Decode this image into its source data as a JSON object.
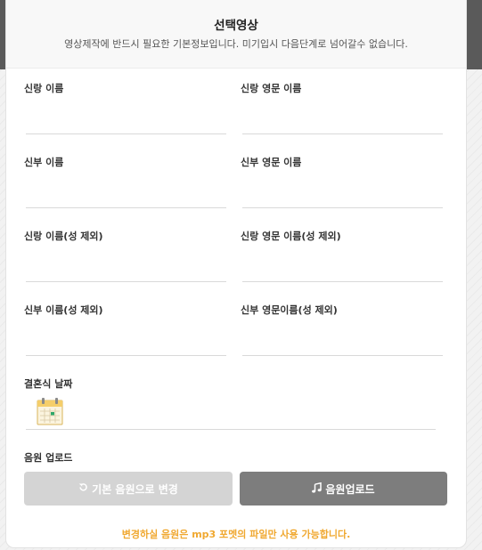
{
  "modal": {
    "title": "선택영상",
    "subtitle": "영상제작에 반드시 필요한 기본정보입니다. 미기입시 다음단계로 넘어갈수 없습니다."
  },
  "fields": {
    "groom_name": {
      "label": "신랑 이름",
      "value": ""
    },
    "groom_name_en": {
      "label": "신랑 영문 이름",
      "value": ""
    },
    "bride_name": {
      "label": "신부 이름",
      "value": ""
    },
    "bride_name_en": {
      "label": "신부 영문 이름",
      "value": ""
    },
    "groom_given_name": {
      "label": "신랑 이름(성 제외)",
      "value": ""
    },
    "groom_given_name_en": {
      "label": "신랑 영문 이름(성 제외)",
      "value": ""
    },
    "bride_given_name": {
      "label": "신부 이름(성 제외)",
      "value": ""
    },
    "bride_given_name_en": {
      "label": "신부 영문이름(성 제외)",
      "value": ""
    },
    "wedding_date": {
      "label": "결혼식 날짜",
      "value": ""
    }
  },
  "audio": {
    "section_label": "음원 업로드",
    "reset_button_label": "기본 음원으로 변경",
    "upload_button_label": "음원업로드",
    "notice": "변경하실 음원은 mp3 포멧의 파일만 사용 가능합니다."
  },
  "icons": {
    "reset": "refresh-icon",
    "upload": "music-note-icon",
    "date": "calendar-icon"
  },
  "colors": {
    "overlay": "#5a5a5a",
    "reset_button": "#d4d4d4",
    "upload_button": "#7d7d7d",
    "notice": "#f0a830",
    "calendar_yellow": "#f5ce6a"
  }
}
